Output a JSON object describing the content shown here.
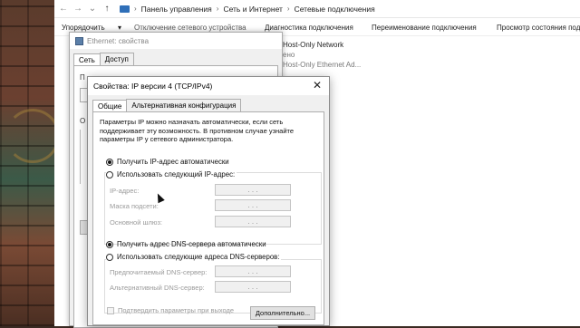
{
  "explorer": {
    "breadcrumb": [
      "Панель управления",
      "Сеть и Интернет",
      "Сетевые подключения"
    ],
    "commands": [
      "Упорядочить",
      "Отключение сетевого устройства",
      "Диагностика подключения",
      "Переименование подключения",
      "Просмотр состояния под"
    ],
    "network_items": [
      {
        "name": "Host-Only Network",
        "status": "ено",
        "adapter": "Host-Only Ethernet Ad..."
      }
    ]
  },
  "ethernet_dialog": {
    "title": "Ethernet: свойства",
    "tabs": [
      "Сеть",
      "Доступ"
    ],
    "partial_label_top": "П",
    "partial_label_mid": "О"
  },
  "ipv4_dialog": {
    "title": "Свойства: IP версии 4 (TCP/IPv4)",
    "close_glyph": "✕",
    "tabs": [
      "Общие",
      "Альтернативная конфигурация"
    ],
    "description": "Параметры IP можно назначать автоматически, если сеть поддерживает эту возможность. В противном случае узнайте параметры IP у сетевого администратора.",
    "ip_auto_label": "Получить IP-адрес автоматически",
    "ip_manual_label": "Использовать следующий IP-адрес:",
    "ip_auto_selected": true,
    "ip_fields": [
      {
        "label": "IP-адрес:",
        "value": ". . ."
      },
      {
        "label": "Маска подсети:",
        "value": ". . ."
      },
      {
        "label": "Основной шлюз:",
        "value": ". . ."
      }
    ],
    "dns_auto_label": "Получить адрес DNS-сервера автоматически",
    "dns_manual_label": "Использовать следующие адреса DNS-серверов:",
    "dns_auto_selected": true,
    "dns_fields": [
      {
        "label": "Предпочитаемый DNS-сервер:",
        "value": ". . ."
      },
      {
        "label": "Альтернативный DNS-сервер:",
        "value": ". . ."
      }
    ],
    "validate_label": "Подтвердить параметры при выходе",
    "advanced_label": "Дополнительно..."
  }
}
